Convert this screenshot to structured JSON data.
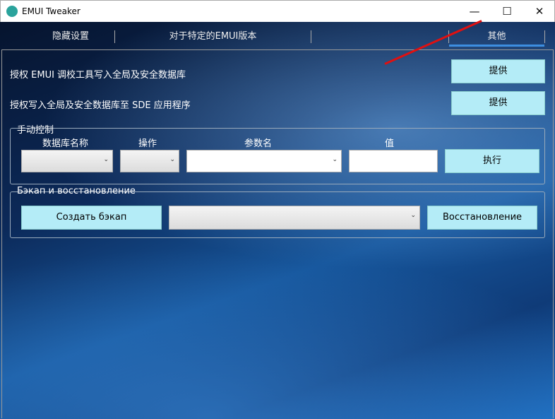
{
  "window": {
    "title": "EMUI Tweaker",
    "minimize": "—",
    "maximize": "☐",
    "close": "✕"
  },
  "tabs": [
    {
      "label": "隐藏设置"
    },
    {
      "label": "对于特定的EMUI版本"
    },
    {
      "label": "其他"
    }
  ],
  "rows": [
    {
      "label": "授权 EMUI 调校工具写入全局及安全数据库",
      "button": "提供"
    },
    {
      "label": "授权写入全局及安全数据库至 SDE 应用程序",
      "button": "提供"
    }
  ],
  "manual": {
    "title": "手动控制",
    "col_db": "数据库名称",
    "col_op": "操作",
    "col_param": "参数名",
    "col_value": "值",
    "execute": "执行",
    "value": ""
  },
  "backup": {
    "title": "Бэкап и восстановление",
    "create": "Создать бэкап",
    "restore": "Восстановление"
  }
}
